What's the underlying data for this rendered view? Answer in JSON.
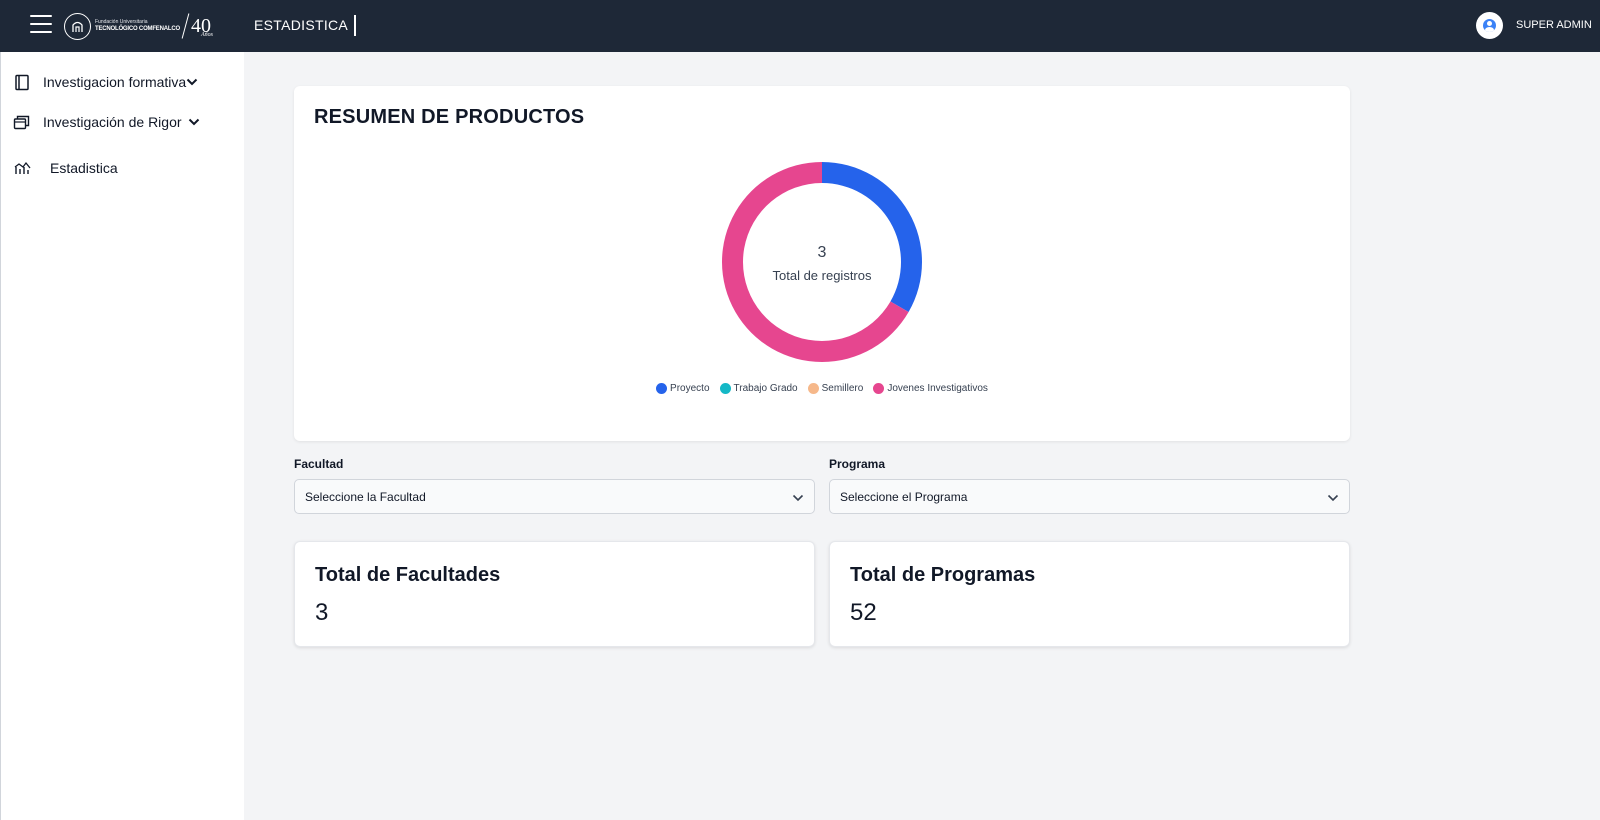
{
  "header": {
    "logo": {
      "line1": "Fundación Universitaria",
      "line2": "TECNOLÓGICO COMFENALCO",
      "anniversary": "40",
      "anniversary_sub": "Años"
    },
    "page_title": "ESTADISTICA",
    "user_name": "SUPER ADMIN"
  },
  "sidebar": {
    "items": [
      {
        "label": "Investigacion formativa",
        "icon": "book-icon",
        "has_submenu": true
      },
      {
        "label": "Investigación de Rigor",
        "icon": "folders-icon",
        "has_submenu": true
      },
      {
        "label": "Estadistica",
        "icon": "chart-line-icon",
        "has_submenu": false
      }
    ]
  },
  "summary": {
    "title": "RESUMEN DE PRODUCTOS",
    "total_value": "3",
    "total_label": "Total de registros"
  },
  "chart_data": {
    "type": "pie",
    "categories": [
      "Proyecto",
      "Trabajo Grado",
      "Semillero",
      "Jovenes Investigativos"
    ],
    "values": [
      1,
      0,
      0,
      2
    ],
    "colors": [
      "#2563eb",
      "#14b8c6",
      "#f6b88a",
      "#e6468f"
    ],
    "legend": "bottom"
  },
  "filters": {
    "facultad": {
      "label": "Facultad",
      "placeholder": "Seleccione la Facultad"
    },
    "programa": {
      "label": "Programa",
      "placeholder": "Seleccione el Programa"
    }
  },
  "stats": {
    "facultades": {
      "title": "Total de Facultades",
      "value": "3"
    },
    "programas": {
      "title": "Total de Programas",
      "value": "52"
    }
  }
}
